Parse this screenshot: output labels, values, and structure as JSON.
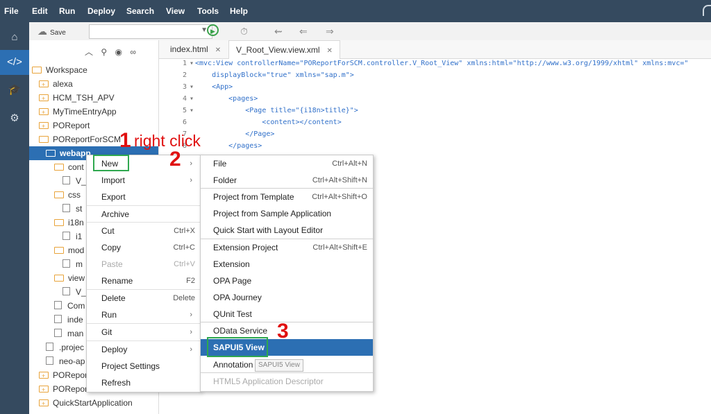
{
  "menubar": {
    "items": [
      "File",
      "Edit",
      "Run",
      "Deploy",
      "Search",
      "View",
      "Tools",
      "Help"
    ]
  },
  "toolbar": {
    "save_label": "Save"
  },
  "tree": {
    "rows": [
      {
        "label": "Workspace",
        "kind": "folder-open"
      },
      {
        "label": "alexa",
        "kind": "folder-plus"
      },
      {
        "label": "HCM_TSH_APV",
        "kind": "folder-plus"
      },
      {
        "label": "MyTimeEntryApp",
        "kind": "folder-plus"
      },
      {
        "label": "POReport",
        "kind": "folder-plus"
      },
      {
        "label": "POReportForSCM",
        "kind": "folder-open"
      },
      {
        "label": "webapp",
        "kind": "folder-open"
      },
      {
        "label": "cont",
        "kind": "folder-open"
      },
      {
        "label": "V_",
        "kind": "doc"
      },
      {
        "label": "css",
        "kind": "folder-open"
      },
      {
        "label": "st",
        "kind": "doc"
      },
      {
        "label": "i18n",
        "kind": "folder-open"
      },
      {
        "label": "i1",
        "kind": "doc"
      },
      {
        "label": "mod",
        "kind": "folder-open"
      },
      {
        "label": "m",
        "kind": "doc"
      },
      {
        "label": "view",
        "kind": "folder-open"
      },
      {
        "label": "V_",
        "kind": "doc"
      },
      {
        "label": "Com",
        "kind": "doc"
      },
      {
        "label": "inde",
        "kind": "doc"
      },
      {
        "label": "man",
        "kind": "doc"
      },
      {
        "label": ".projec",
        "kind": "doc"
      },
      {
        "label": "neo-ap",
        "kind": "doc"
      },
      {
        "label": "POReport",
        "kind": "folder-plus"
      },
      {
        "label": "POReportSCM",
        "kind": "folder-plus"
      },
      {
        "label": "QuickStartApplication",
        "kind": "folder-plus"
      }
    ]
  },
  "editor": {
    "tabs": [
      "index.html",
      "V_Root_View.view.xml"
    ],
    "lines": [
      {
        "n": "1",
        "fold": true,
        "text": "<mvc:View controllerName=\"POReportForSCM.controller.V_Root_View\" xmlns:html=\"http://www.w3.org/1999/xhtml\" xmlns:mvc=\""
      },
      {
        "n": "2",
        "fold": false,
        "text": "    displayBlock=\"true\" xmlns=\"sap.m\">"
      },
      {
        "n": "3",
        "fold": true,
        "text": "    <App>"
      },
      {
        "n": "4",
        "fold": true,
        "text": "        <pages>"
      },
      {
        "n": "5",
        "fold": true,
        "text": "            <Page title=\"{i18n>title}\">"
      },
      {
        "n": "6",
        "fold": false,
        "text": "                <content></content>"
      },
      {
        "n": "7",
        "fold": false,
        "text": "            </Page>"
      },
      {
        "n": "8",
        "fold": false,
        "text": "        </pages>"
      }
    ]
  },
  "context_menu": {
    "items": [
      {
        "label": "New",
        "shortcut": "",
        "submenu": true,
        "disabled": false
      },
      {
        "label": "Import",
        "shortcut": "",
        "submenu": true,
        "disabled": false
      },
      {
        "label": "Export",
        "shortcut": "",
        "submenu": false,
        "disabled": false
      },
      {
        "label": "Archive",
        "shortcut": "",
        "submenu": false,
        "disabled": false
      },
      {
        "label": "Cut",
        "shortcut": "Ctrl+X",
        "submenu": false,
        "disabled": false
      },
      {
        "label": "Copy",
        "shortcut": "Ctrl+C",
        "submenu": false,
        "disabled": false
      },
      {
        "label": "Paste",
        "shortcut": "Ctrl+V",
        "submenu": false,
        "disabled": true
      },
      {
        "label": "Rename",
        "shortcut": "F2",
        "submenu": false,
        "disabled": false
      },
      {
        "label": "Delete",
        "shortcut": "Delete",
        "submenu": false,
        "disabled": false
      },
      {
        "label": "Run",
        "shortcut": "",
        "submenu": true,
        "disabled": false
      },
      {
        "label": "Git",
        "shortcut": "",
        "submenu": true,
        "disabled": false
      },
      {
        "label": "Deploy",
        "shortcut": "",
        "submenu": true,
        "disabled": false
      },
      {
        "label": "Project Settings",
        "shortcut": "",
        "submenu": false,
        "disabled": false
      },
      {
        "label": "Refresh",
        "shortcut": "",
        "submenu": false,
        "disabled": false
      }
    ]
  },
  "submenu": {
    "items": [
      {
        "label": "File",
        "shortcut": "Ctrl+Alt+N"
      },
      {
        "label": "Folder",
        "shortcut": "Ctrl+Alt+Shift+N"
      },
      {
        "label": "Project from Template",
        "shortcut": "Ctrl+Alt+Shift+O"
      },
      {
        "label": "Project from Sample Application",
        "shortcut": ""
      },
      {
        "label": "Quick Start with Layout Editor",
        "shortcut": ""
      },
      {
        "label": "Extension Project",
        "shortcut": "Ctrl+Alt+Shift+E"
      },
      {
        "label": "Extension",
        "shortcut": ""
      },
      {
        "label": "OPA Page",
        "shortcut": ""
      },
      {
        "label": "OPA Journey",
        "shortcut": ""
      },
      {
        "label": "QUnit Test",
        "shortcut": ""
      },
      {
        "label": "OData Service",
        "shortcut": ""
      },
      {
        "label": "SAPUI5 View",
        "shortcut": "",
        "highlighted": true
      },
      {
        "label": "Annotation File",
        "shortcut": ""
      },
      {
        "label": "HTML5 Application Descriptor",
        "shortcut": "",
        "disabled": true
      }
    ],
    "tooltip": "SAPUI5 View"
  },
  "annotations": {
    "step1_number": "1",
    "step1_text": "right click",
    "step2_number": "2",
    "step3_number": "3"
  },
  "colors": {
    "menubar": "#354a5f",
    "selection": "#2c6fb3",
    "annotation_red": "#e01010",
    "annotation_green": "#2fa84f"
  }
}
